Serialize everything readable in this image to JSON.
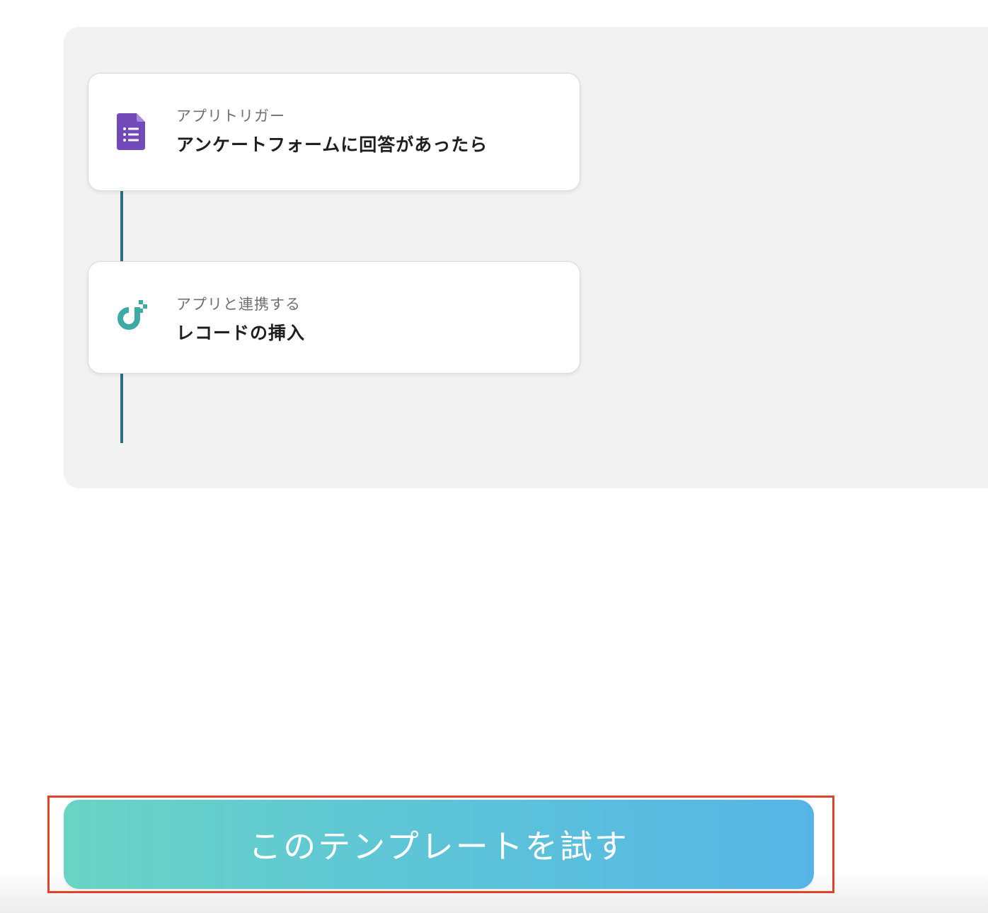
{
  "flow": {
    "steps": [
      {
        "kind": "アプリトリガー",
        "title": "アンケートフォームに回答があったら",
        "icon": "google-forms-icon",
        "icon_color": "#7249b8"
      },
      {
        "kind": "アプリと連携する",
        "title": "レコードの挿入",
        "icon": "app-logo-icon",
        "icon_color": "#3fa9a5"
      }
    ],
    "connector_color": "#2f6c86"
  },
  "cta": {
    "label": "このテンプレートを試す",
    "gradient_start": "#69d4c4",
    "gradient_end": "#56b5e5"
  },
  "highlight_color": "#e0432a"
}
